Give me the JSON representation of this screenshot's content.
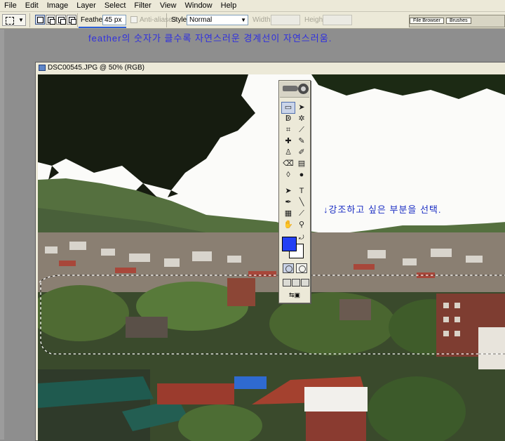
{
  "menubar": {
    "items": [
      "File",
      "Edit",
      "Image",
      "Layer",
      "Select",
      "Filter",
      "View",
      "Window",
      "Help"
    ]
  },
  "options_bar": {
    "feather_label": "Feather:",
    "feather_value": "45 px",
    "antialias_label": "Anti-aliased",
    "style_label": "Style:",
    "style_value": "Normal",
    "width_label": "Width:",
    "height_label": "Height:"
  },
  "palette_well": {
    "tabs": [
      "File Browser",
      "Brushes"
    ]
  },
  "annotation_top": "feather의 숫자가 클수록 자연스러운 경계선이 자연스러움.",
  "annotation_photo": "↓강조하고 싶은 부분을 선택.",
  "document": {
    "title": "DSC00545.JPG @ 50% (RGB)"
  },
  "toolbox": {
    "foreground_color": "#2340f4",
    "background_color": "#ffffff"
  }
}
